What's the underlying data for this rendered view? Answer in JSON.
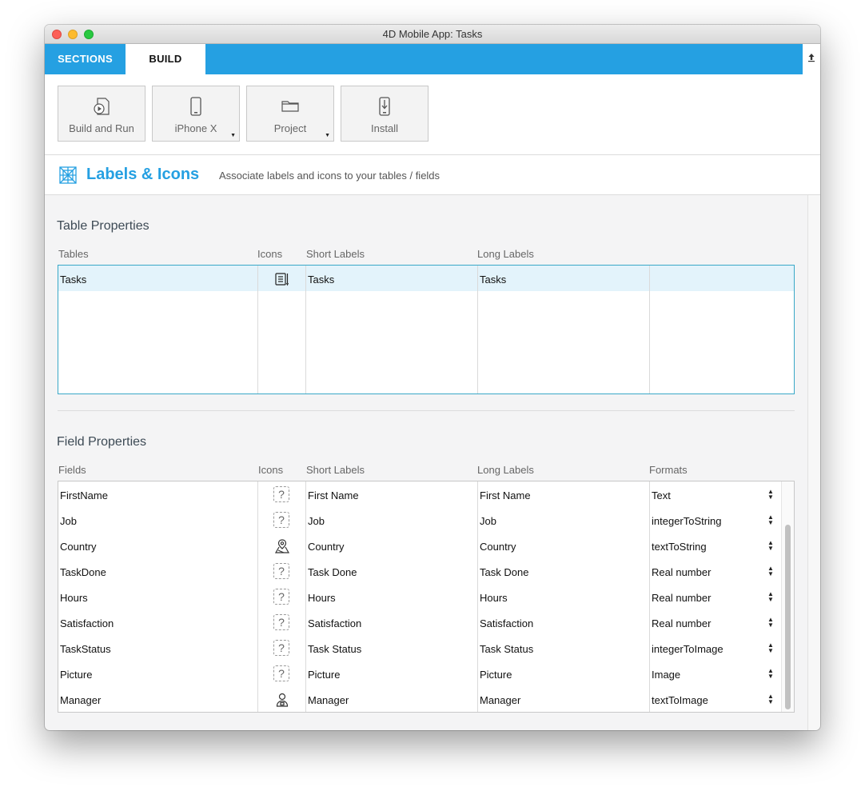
{
  "window": {
    "title": "4D Mobile App: Tasks"
  },
  "tabs": {
    "sections": "SECTIONS",
    "build": "BUILD",
    "upload_icon": "upload-icon"
  },
  "toolbar": {
    "build_run": "Build and Run",
    "device": "iPhone X",
    "project": "Project",
    "install": "Install"
  },
  "section": {
    "title": "Labels & Icons",
    "subtitle": "Associate labels and icons to your tables / fields"
  },
  "table_properties": {
    "title": "Table Properties",
    "columns": {
      "tables": "Tables",
      "icons": "Icons",
      "short": "Short Labels",
      "long": "Long Labels"
    },
    "rows": [
      {
        "table": "Tasks",
        "icon": "tasks-icon",
        "short": "Tasks",
        "long": "Tasks"
      }
    ]
  },
  "field_properties": {
    "title": "Field Properties",
    "columns": {
      "fields": "Fields",
      "icons": "Icons",
      "short": "Short Labels",
      "long": "Long Labels",
      "formats": "Formats"
    },
    "rows": [
      {
        "field": "FirstName",
        "icon": "question-icon",
        "short": "First Name",
        "long": "First Name",
        "format": "Text"
      },
      {
        "field": "Job",
        "icon": "question-icon",
        "short": "Job",
        "long": "Job",
        "format": "integerToString"
      },
      {
        "field": "Country",
        "icon": "map-pin-icon",
        "short": "Country",
        "long": "Country",
        "format": "textToString"
      },
      {
        "field": "TaskDone",
        "icon": "question-icon",
        "short": "Task Done",
        "long": "Task Done",
        "format": "Real number"
      },
      {
        "field": "Hours",
        "icon": "question-icon",
        "short": "Hours",
        "long": "Hours",
        "format": "Real number"
      },
      {
        "field": "Satisfaction",
        "icon": "question-icon",
        "short": "Satisfaction",
        "long": "Satisfaction",
        "format": "Real number"
      },
      {
        "field": "TaskStatus",
        "icon": "question-icon",
        "short": "Task Status",
        "long": "Task Status",
        "format": "integerToImage"
      },
      {
        "field": "Picture",
        "icon": "question-icon",
        "short": "Picture",
        "long": "Picture",
        "format": "Image"
      },
      {
        "field": "Manager",
        "icon": "person-icon",
        "short": "Manager",
        "long": "Manager",
        "format": "textToImage"
      }
    ]
  },
  "colors": {
    "accent": "#25a0e2",
    "selection": "#e3f3fb",
    "focus_border": "#39a8c7"
  }
}
